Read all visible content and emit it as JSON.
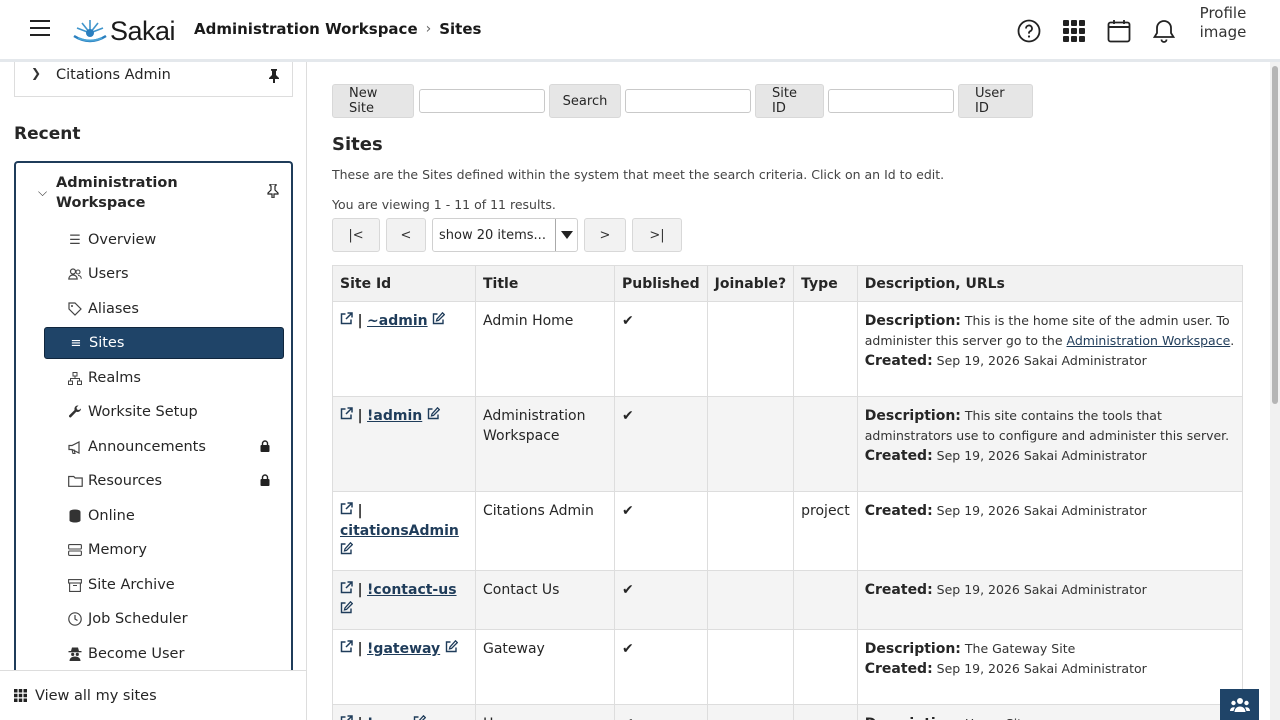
{
  "header": {
    "logo_text": "Sakai",
    "breadcrumb": {
      "workspace": "Administration Workspace",
      "current": "Sites"
    },
    "profile_alt": "Profile image"
  },
  "sidebar": {
    "pinned_site": "Citations Admin",
    "recent_title": "Recent",
    "group_title": "Administration Workspace",
    "tools": [
      {
        "label": "Overview",
        "icon": "list-icon"
      },
      {
        "label": "Users",
        "icon": "users-icon"
      },
      {
        "label": "Aliases",
        "icon": "tag-icon"
      },
      {
        "label": "Sites",
        "icon": "list-icon",
        "active": true
      },
      {
        "label": "Realms",
        "icon": "sitemap-icon"
      },
      {
        "label": "Worksite Setup",
        "icon": "wrench-icon"
      },
      {
        "label": "Announcements",
        "icon": "megaphone-icon",
        "locked": true
      },
      {
        "label": "Resources",
        "icon": "folder-icon",
        "locked": true
      },
      {
        "label": "Online",
        "icon": "database-icon"
      },
      {
        "label": "Memory",
        "icon": "server-icon"
      },
      {
        "label": "Site Archive",
        "icon": "archive-icon"
      },
      {
        "label": "Job Scheduler",
        "icon": "clock-icon"
      },
      {
        "label": "Become User",
        "icon": "user-secret-icon"
      }
    ],
    "view_all": "View all my sites"
  },
  "main": {
    "toolbar": {
      "new_site": "New Site",
      "search": "Search",
      "site_id": "Site ID",
      "user_id": "User ID"
    },
    "title": "Sites",
    "instructions": "These are the Sites defined within the system that meet the search criteria. Click on an Id to edit.",
    "viewing": "You are viewing 1 - 11 of 11 results.",
    "pager": {
      "first": "|<",
      "prev": "<",
      "page_size": "show 20 items...",
      "next": ">",
      "last": ">|"
    },
    "columns": [
      "Site Id",
      "Title",
      "Published",
      "Joinable?",
      "Type",
      "Description, URLs"
    ],
    "rows": [
      {
        "site_id": "~admin",
        "title": "Admin Home",
        "published": "✔",
        "joinable": "",
        "type": "",
        "desc_pre": "This is the home site of the admin user. To administer this server go to the ",
        "desc_link": "Administration Workspace",
        "desc_post": ".",
        "created": "Sep 19, 2026 Sakai Administrator"
      },
      {
        "site_id": "!admin",
        "title": "Administration Workspace",
        "published": "✔",
        "joinable": "",
        "type": "",
        "desc_pre": "This site contains the tools that adminstrators use to configure and administer this server.",
        "desc_link": "",
        "desc_post": "",
        "created": "Sep 19, 2026 Sakai Administrator"
      },
      {
        "site_id": "citationsAdmin",
        "title": "Citations Admin",
        "published": "✔",
        "joinable": "",
        "type": "project",
        "desc_pre": "",
        "desc_link": "",
        "desc_post": "",
        "created": "Sep 19, 2026 Sakai Administrator"
      },
      {
        "site_id": "!contact-us",
        "title": "Contact Us",
        "published": "✔",
        "joinable": "",
        "type": "",
        "desc_pre": "",
        "desc_link": "",
        "desc_post": "",
        "created": "Sep 19, 2026 Sakai Administrator"
      },
      {
        "site_id": "!gateway",
        "title": "Gateway",
        "published": "✔",
        "joinable": "",
        "type": "",
        "desc_pre": "The Gateway Site",
        "desc_link": "",
        "desc_post": "",
        "created": "Sep 19, 2026 Sakai Administrator"
      },
      {
        "site_id": "!user",
        "title": "Home",
        "published": "✔",
        "joinable": "",
        "type": "",
        "desc_pre": "Home Site",
        "desc_link": "",
        "desc_post": "",
        "created": ""
      }
    ],
    "labels": {
      "description": "Description:",
      "created": "Created:"
    }
  },
  "colors": {
    "accent": "#1f4468",
    "link": "#1f3c5a",
    "table_header": "#f2f2f2"
  }
}
